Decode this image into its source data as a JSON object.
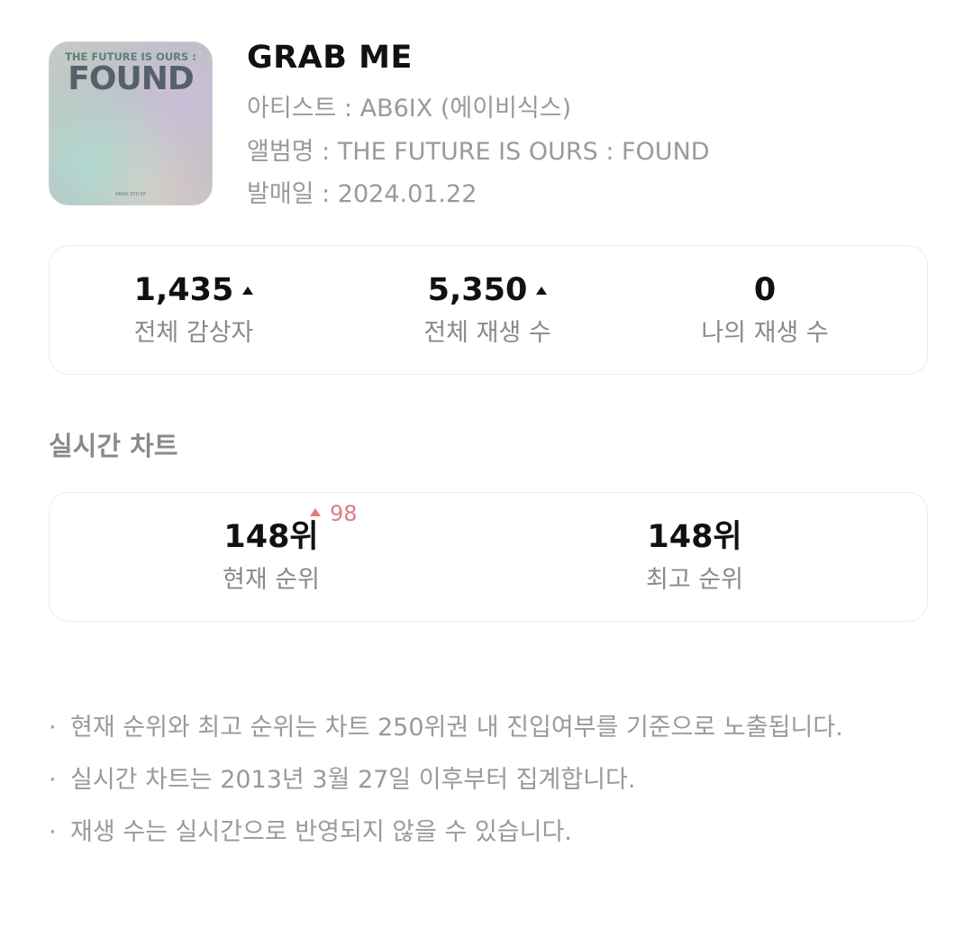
{
  "album": {
    "cover": {
      "line_top": "THE FUTURE IS OURS :",
      "line_big": "FOUND",
      "line_small": "AB6IX 9TH EP",
      "icon": "album-cover-art"
    },
    "title": "GRAB ME",
    "artist_line": "아티스트 : AB6IX (에이비식스)",
    "album_line": "앨범명 : THE FUTURE IS OURS : FOUND",
    "release_line": "발매일 : 2024.01.22"
  },
  "stats": [
    {
      "value": "1,435",
      "label": "전체 감상자",
      "trend": "up",
      "icon": "up-triangle-icon"
    },
    {
      "value": "5,350",
      "label": "전체 재생 수",
      "trend": "up",
      "icon": "up-triangle-icon"
    },
    {
      "value": "0",
      "label": "나의 재생 수",
      "trend": "none"
    }
  ],
  "realtime": {
    "section_title": "실시간 차트",
    "current": {
      "value": "148위",
      "label": "현재 순위",
      "change": "98",
      "change_icon": "up-triangle-icon",
      "change_color": "#e27a80"
    },
    "best": {
      "value": "148위",
      "label": "최고 순위"
    }
  },
  "notes": [
    {
      "bullet": "·",
      "text": "현재 순위와 최고 순위는 차트 250위권 내 진입여부를 기준으로 노출됩니다."
    },
    {
      "bullet": "·",
      "text": "실시간 차트는 2013년 3월 27일 이후부터 집계합니다."
    },
    {
      "bullet": "·",
      "text": "재생 수는 실시간으로 반영되지 않을 수 있습니다."
    }
  ],
  "colors": {
    "primary_text": "#111111",
    "secondary_text": "#9a9a9a",
    "card_border": "#ececec",
    "rank_up": "#e27a80"
  }
}
